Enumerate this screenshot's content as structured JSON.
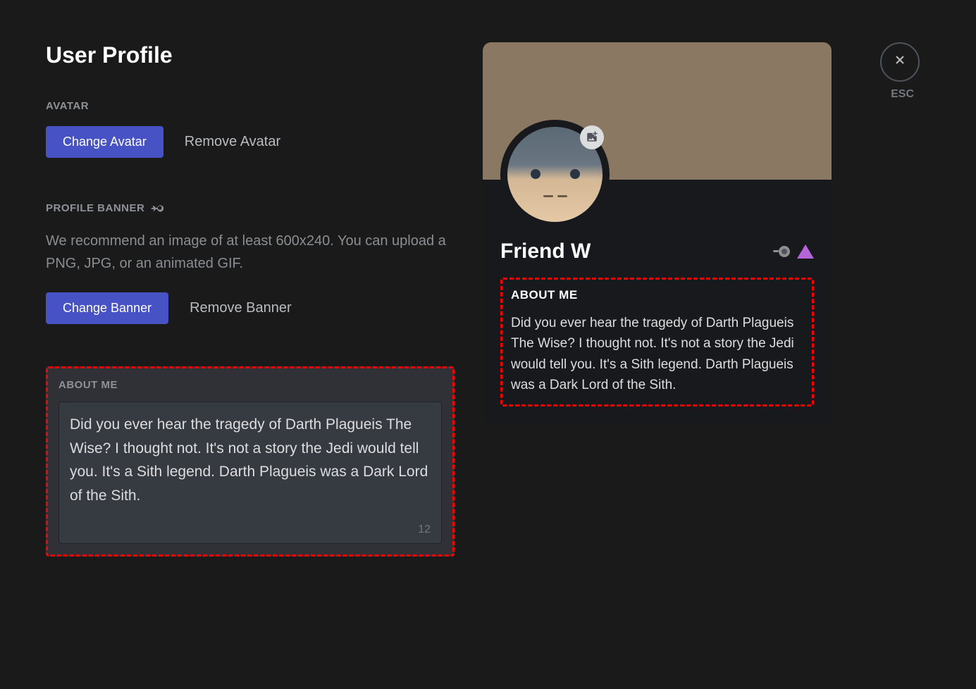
{
  "page_title": "User Profile",
  "close_button": {
    "esc_label": "ESC"
  },
  "avatar_section": {
    "label": "AVATAR",
    "change_button": "Change Avatar",
    "remove_button": "Remove Avatar"
  },
  "banner_section": {
    "label": "PROFILE BANNER",
    "description": "We recommend an image of at least 600x240. You can upload a PNG, JPG, or an animated GIF.",
    "change_button": "Change Banner",
    "remove_button": "Remove Banner"
  },
  "about_input": {
    "label": "ABOUT ME",
    "value": "Did you ever hear the tragedy of Darth Plagueis The Wise? I thought not. It's not a story the Jedi would tell you. It's a Sith legend. Darth Plagueis was a Dark Lord of the Sith.",
    "char_count": "12"
  },
  "profile_preview": {
    "username": "Friend W",
    "about_label": "ABOUT ME",
    "about_text": "Did you ever hear the tragedy of Darth Plagueis The Wise? I thought not. It's not a story the Jedi would tell you. It's a Sith legend. Darth Plagueis was a Dark Lord of the Sith."
  }
}
